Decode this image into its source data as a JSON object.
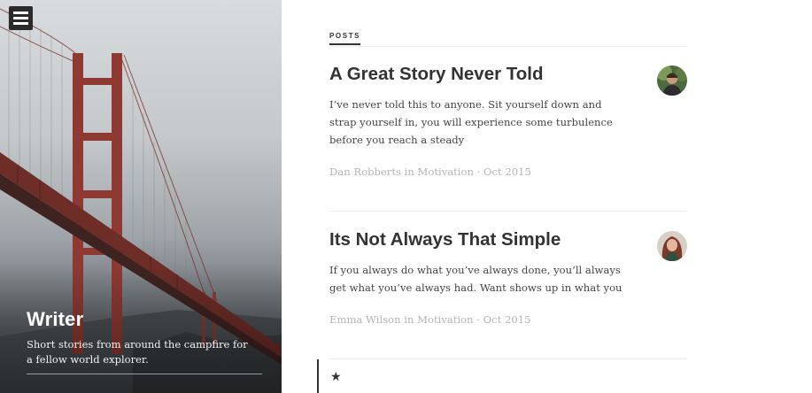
{
  "menu": {
    "icon": "hamburger-menu-icon"
  },
  "site": {
    "title": "Writer",
    "description": "Short stories from around the campfire for a fellow world explorer."
  },
  "section_label": "POSTS",
  "posts": [
    {
      "title": "A Great Story Never Told",
      "excerpt": "I’ve never told this to anyone. Sit yourself down and strap yourself in, you will experience some turbulence before you reach a steady",
      "meta": "Dan Robberts in Motivation · Oct 2015",
      "avatar_icon": "author-avatar"
    },
    {
      "title": "Its Not Always That Simple",
      "excerpt": "If you always do what you’ve always done, you’ll always get what you’ve always had. Want shows up in what you",
      "meta": "Emma Wilson in Motivation · Oct 2015",
      "avatar_icon": "author-avatar"
    }
  ],
  "featured_icon": "star-icon",
  "colors": {
    "accent": "#333333",
    "meta": "#b4b4b4",
    "bridge": "#8e3a32"
  }
}
